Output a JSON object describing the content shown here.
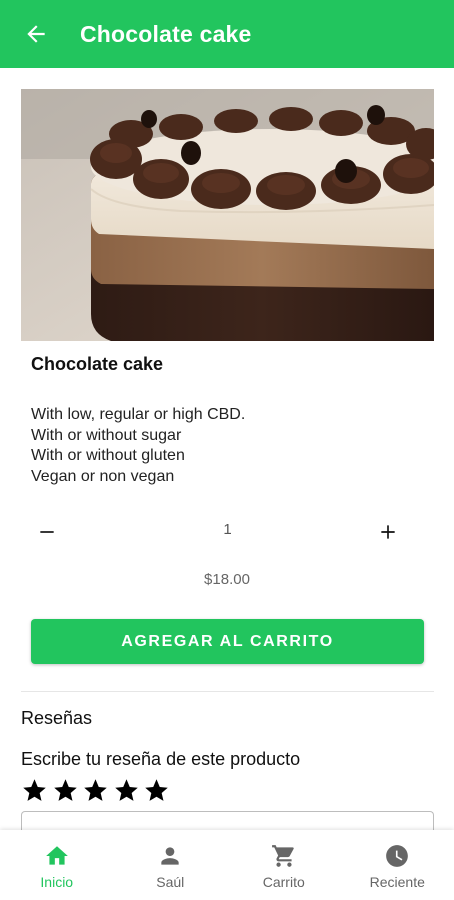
{
  "appbar": {
    "title": "Chocolate cake",
    "back_icon": "arrow-left-icon"
  },
  "product": {
    "image": "chocolate-cake-photo",
    "name": "Chocolate cake",
    "description_lines": [
      "With low, regular or high CBD.",
      "With or without sugar",
      "With or without gluten",
      "Vegan or non vegan"
    ],
    "quantity": "1",
    "price": "$18.00",
    "add_to_cart_label": "AGREGAR AL CARRITO"
  },
  "reviews": {
    "title": "Reseñas",
    "write_title": "Escribe tu reseña de este producto",
    "rating": 5,
    "max_rating": 5
  },
  "bottom_nav": [
    {
      "label": "Inicio",
      "icon": "home-icon",
      "active": true
    },
    {
      "label": "Saúl",
      "icon": "person-icon",
      "active": false
    },
    {
      "label": "Carrito",
      "icon": "cart-icon",
      "active": false
    },
    {
      "label": "Reciente",
      "icon": "clock-icon",
      "active": false
    }
  ],
  "colors": {
    "accent": "#22c55e",
    "inactive": "#666666"
  }
}
